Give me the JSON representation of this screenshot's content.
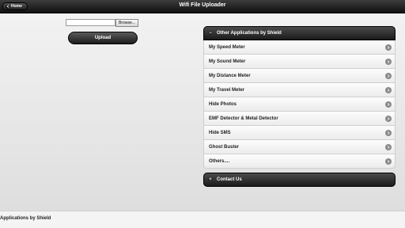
{
  "header": {
    "title": "Wifi File Uploader",
    "home_label": "Home"
  },
  "upload": {
    "file_value": "",
    "browse_label": "Browse...",
    "upload_label": "Upload"
  },
  "other_apps": {
    "title": "Other Applications by Shield",
    "expanded_icon": "−",
    "items": [
      {
        "label": "My Speed Meter"
      },
      {
        "label": "My Sound Meter"
      },
      {
        "label": "My Distance Meter"
      },
      {
        "label": "My Travel Meter"
      },
      {
        "label": "Hide Photos"
      },
      {
        "label": "EMF Detector & Metal Detector"
      },
      {
        "label": "Hide SMS"
      },
      {
        "label": "Ghost Buster"
      },
      {
        "label": "Others...."
      }
    ]
  },
  "contact": {
    "title": "Contact Us",
    "collapsed_icon": "+"
  },
  "footer": {
    "text": "Applications by Shield"
  }
}
